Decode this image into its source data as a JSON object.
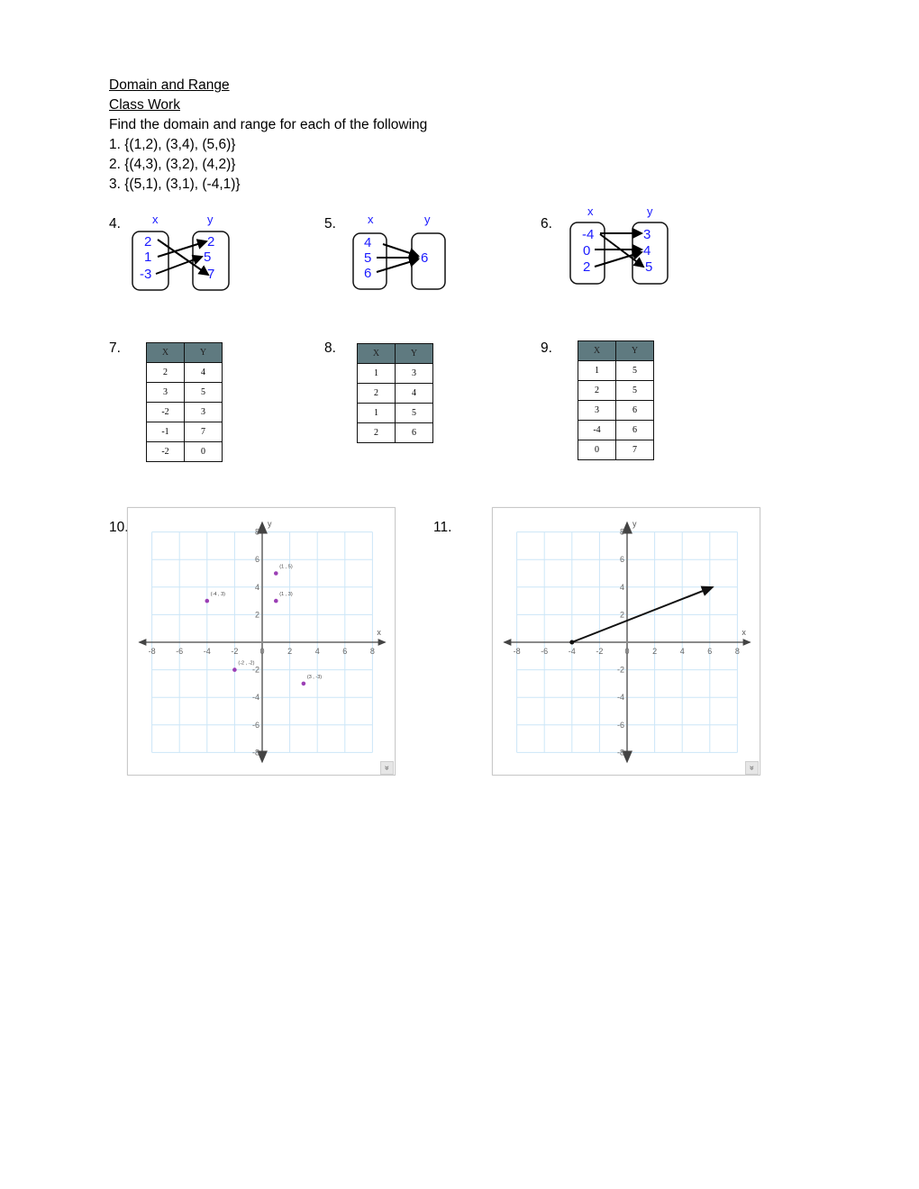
{
  "header": {
    "title": "Domain and Range",
    "subtitle": "Class Work",
    "instructions": "Find the domain and range for each of the following"
  },
  "problems_sets": [
    {
      "label": "1. {(1,2), (3,4), (5,6)}"
    },
    {
      "label": "2. {(4,3), (3,2), (4,2)}"
    },
    {
      "label": "3. {(5,1), (3,1), (-4,1)}"
    }
  ],
  "mappings": [
    {
      "number": "4.",
      "x_label": "x",
      "y_label": "y",
      "domain": [
        "2",
        "1",
        "-3"
      ],
      "range": [
        "2",
        "5",
        "7"
      ],
      "arrows": [
        [
          "2",
          "7"
        ],
        [
          "1",
          "2"
        ],
        [
          "-3",
          "5"
        ]
      ]
    },
    {
      "number": "5.",
      "x_label": "x",
      "y_label": "y",
      "domain": [
        "4",
        "5",
        "6"
      ],
      "range": [
        "6"
      ],
      "arrows": [
        [
          "4",
          "6"
        ],
        [
          "5",
          "6"
        ],
        [
          "6",
          "6"
        ]
      ]
    },
    {
      "number": "6.",
      "x_label": "x",
      "y_label": "y",
      "domain": [
        "-4",
        "0",
        "2"
      ],
      "range": [
        "3",
        "4",
        "5"
      ],
      "arrows": [
        [
          "-4",
          "3"
        ],
        [
          "-4",
          "5"
        ],
        [
          "0",
          "4"
        ],
        [
          "2",
          "4"
        ]
      ]
    }
  ],
  "tables": [
    {
      "number": "7.",
      "headers": [
        "X",
        "Y"
      ],
      "rows": [
        [
          "2",
          "4"
        ],
        [
          "3",
          "5"
        ],
        [
          "-2",
          "3"
        ],
        [
          "-1",
          "7"
        ],
        [
          "-2",
          "0"
        ]
      ]
    },
    {
      "number": "8.",
      "headers": [
        "X",
        "Y"
      ],
      "rows": [
        [
          "1",
          "3"
        ],
        [
          "2",
          "4"
        ],
        [
          "1",
          "5"
        ],
        [
          "2",
          "6"
        ]
      ]
    },
    {
      "number": "9.",
      "headers": [
        "X",
        "Y"
      ],
      "rows": [
        [
          "1",
          "5"
        ],
        [
          "2",
          "5"
        ],
        [
          "3",
          "6"
        ],
        [
          "-4",
          "6"
        ],
        [
          "0",
          "7"
        ]
      ]
    }
  ],
  "colors": {
    "mapping_text": "#1a1aff",
    "table_header": "#5f7a80",
    "grid": "#cce6f7",
    "axis": "#777777",
    "point": "#9b3fb5"
  },
  "chart_data": [
    {
      "number": "10.",
      "type": "scatter",
      "title": "",
      "xlabel": "x",
      "ylabel": "y",
      "xlim": [
        -8,
        8
      ],
      "ylim": [
        -8,
        8
      ],
      "grid": true,
      "x_ticks": [
        "-8",
        "-6",
        "-4",
        "-2",
        "0",
        "2",
        "4",
        "6",
        "8"
      ],
      "y_ticks": [
        "8",
        "6",
        "4",
        "2",
        "-2",
        "-4",
        "-6",
        "-8"
      ],
      "points": [
        {
          "x": 1,
          "y": 5,
          "label": "(1 , 5)"
        },
        {
          "x": -4,
          "y": 3,
          "label": "(-4 , 3)"
        },
        {
          "x": 1,
          "y": 3,
          "label": "(1 , 3)"
        },
        {
          "x": -2,
          "y": -2,
          "label": "(-2 , -2)"
        },
        {
          "x": 3,
          "y": -3,
          "label": "(3 , -3)"
        }
      ]
    },
    {
      "number": "11.",
      "type": "line",
      "title": "",
      "xlabel": "x",
      "ylabel": "y",
      "xlim": [
        -8,
        8
      ],
      "ylim": [
        -8,
        8
      ],
      "grid": true,
      "x_ticks": [
        "-8",
        "-6",
        "-4",
        "-2",
        "0",
        "2",
        "4",
        "6",
        "8"
      ],
      "y_ticks": [
        "8",
        "6",
        "4",
        "2",
        "-2",
        "-4",
        "-6",
        "-8"
      ],
      "ray": {
        "start": {
          "x": -4,
          "y": 0,
          "endpoint": "closed"
        },
        "through": {
          "x": 6.2,
          "y": 4
        },
        "arrow": true
      }
    }
  ]
}
